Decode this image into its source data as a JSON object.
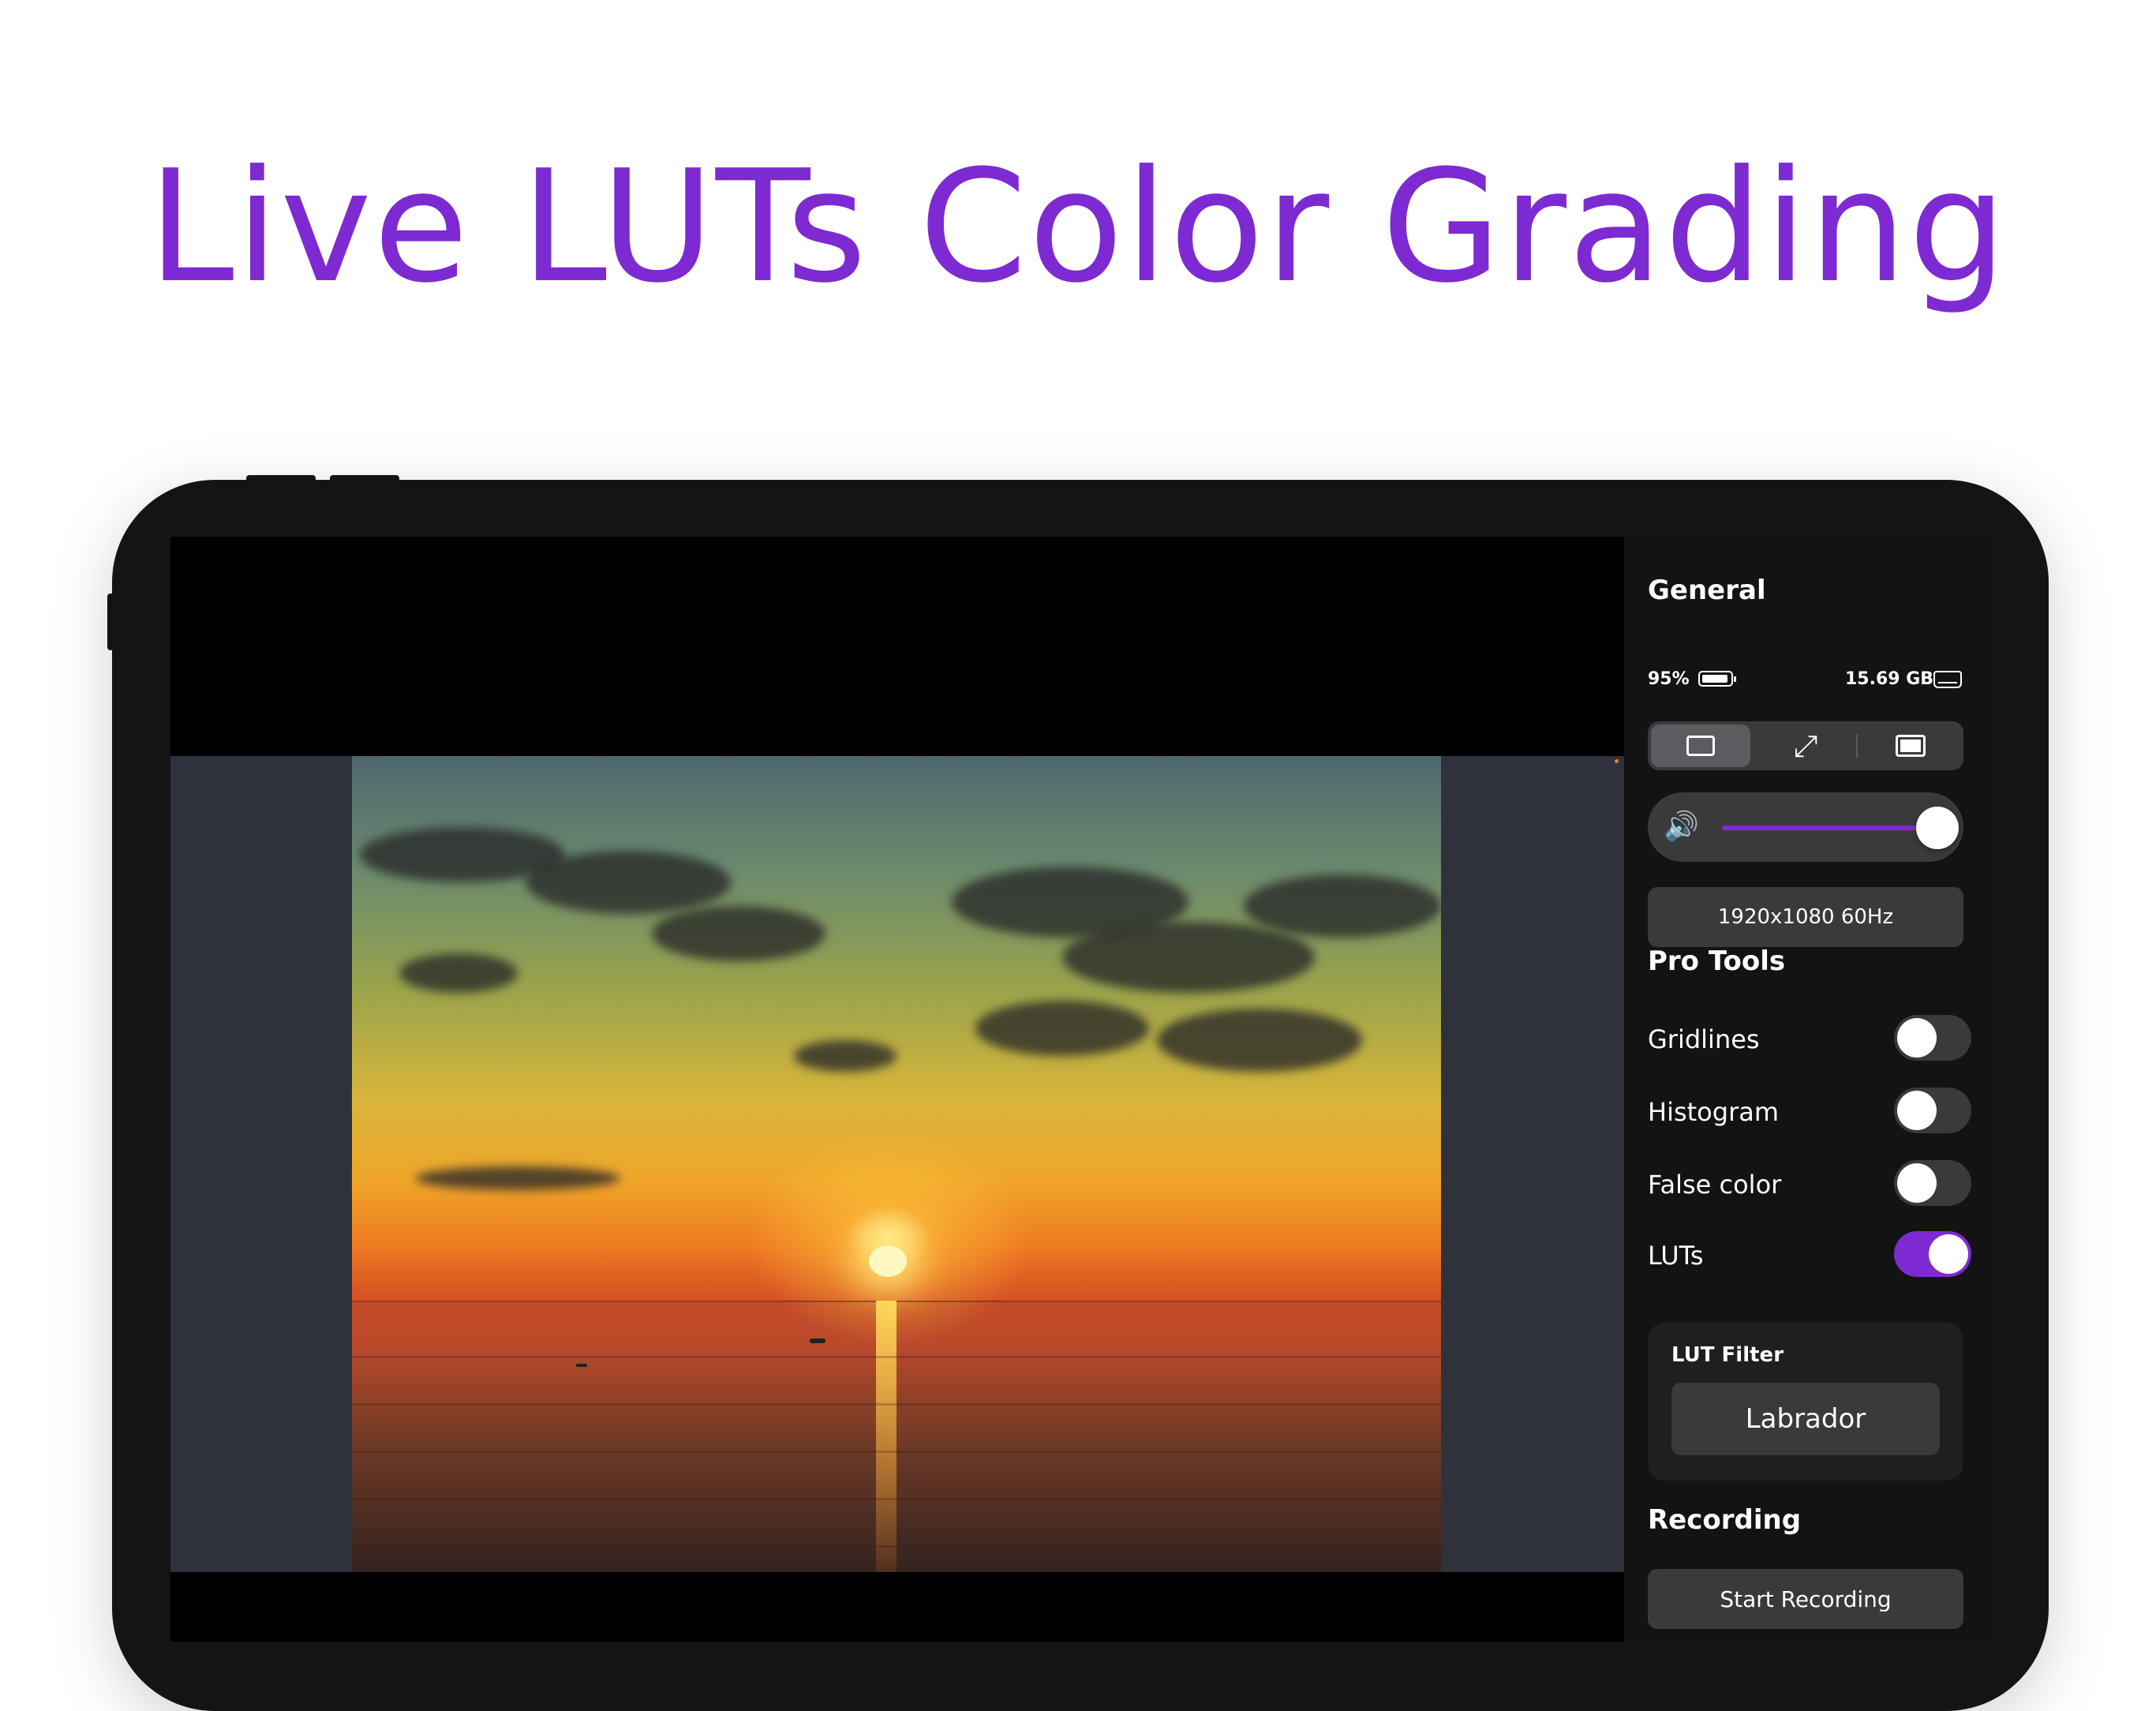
{
  "headline": "Live LUTs Color Grading",
  "panel": {
    "general_title": "General",
    "battery": "95%",
    "storage": "15.69 GB",
    "view_modes": [
      {
        "icon": "window-icon",
        "active": true
      },
      {
        "icon": "expand-arrows-icon",
        "active": false
      },
      {
        "icon": "fill-screen-icon",
        "active": false
      }
    ],
    "volume": {
      "icon": "speaker-icon",
      "level": 1.0,
      "accent": "#7e2ad2"
    },
    "resolution": "1920x1080 60Hz",
    "pro_tools_title": "Pro Tools",
    "tools": [
      {
        "label": "Gridlines",
        "on": false
      },
      {
        "label": "Histogram",
        "on": false
      },
      {
        "label": "False color",
        "on": false
      },
      {
        "label": "LUTs",
        "on": true
      }
    ],
    "lut_filter": {
      "title": "LUT Filter",
      "value": "Labrador"
    },
    "recording_title": "Recording",
    "record_button": "Start Recording"
  },
  "colors": {
    "accent": "#7e2ad2",
    "panel_bg": "#131313",
    "control_bg": "#3a3a3c"
  }
}
